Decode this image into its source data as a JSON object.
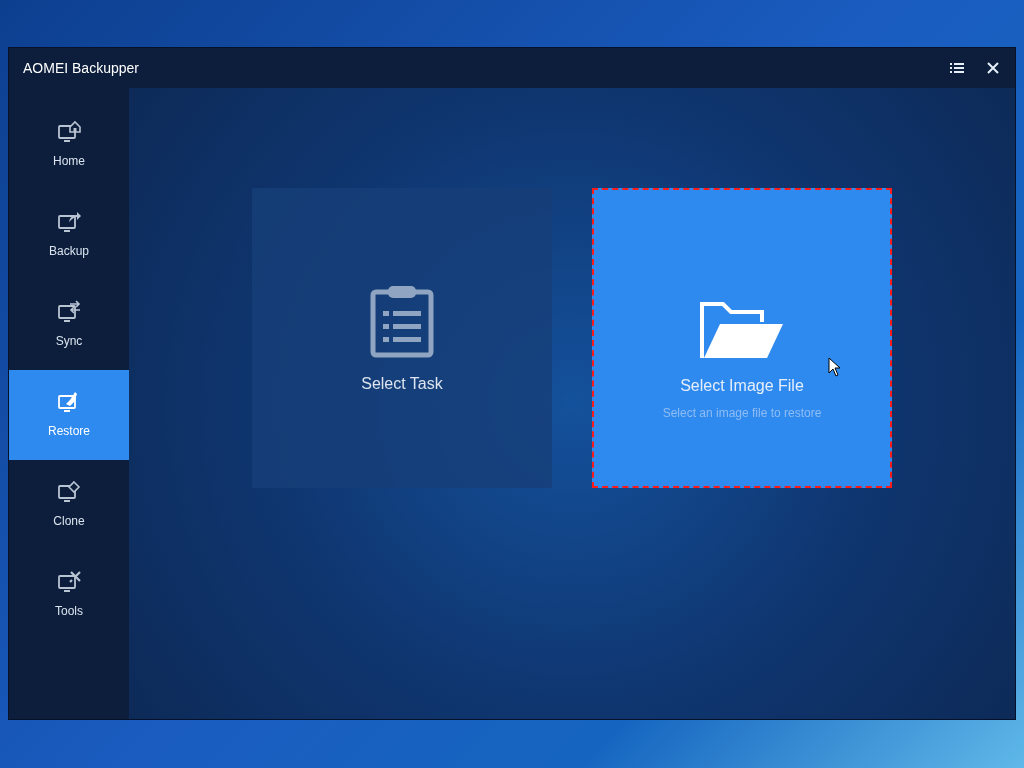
{
  "window": {
    "title": "AOMEI Backupper"
  },
  "sidebar": {
    "items": [
      {
        "label": "Home",
        "selected": false
      },
      {
        "label": "Backup",
        "selected": false
      },
      {
        "label": "Sync",
        "selected": false
      },
      {
        "label": "Restore",
        "selected": true
      },
      {
        "label": "Clone",
        "selected": false
      },
      {
        "label": "Tools",
        "selected": false
      }
    ]
  },
  "cards": [
    {
      "title": "Select Task",
      "selected": false
    },
    {
      "title": "Select Image File",
      "subtitle": "Select an image file to restore",
      "selected": true
    }
  ]
}
